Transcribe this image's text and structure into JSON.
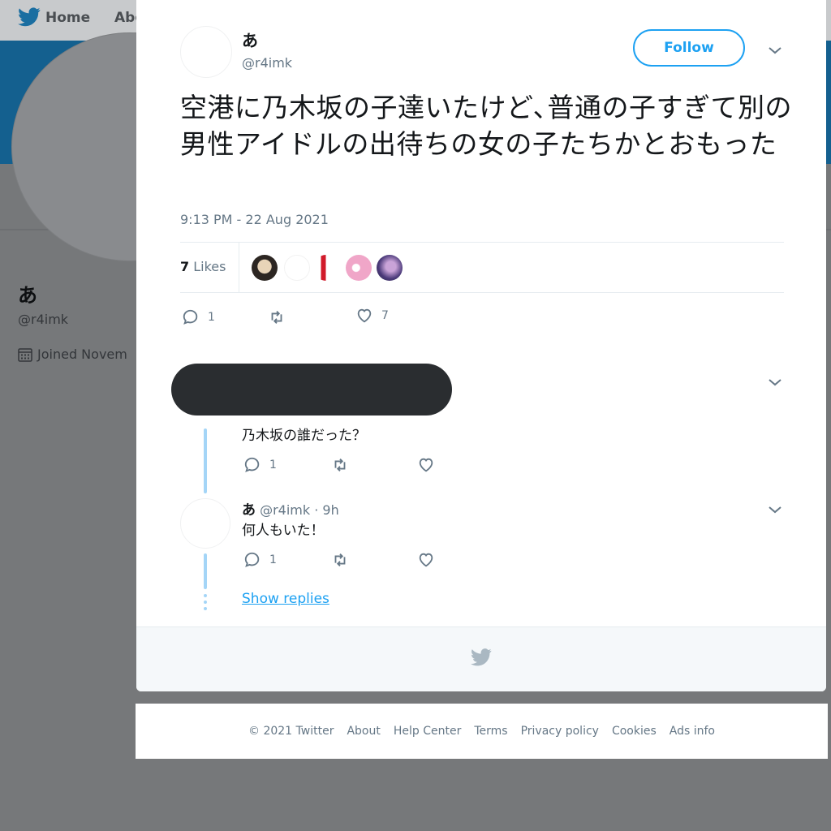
{
  "background": {
    "nav": {
      "home": "Home",
      "about": "Abo"
    },
    "profile": {
      "name": "あ",
      "handle": "@r4imk",
      "joined": "Joined Novem"
    },
    "colors": {
      "banner": "#14608f",
      "overlay": "#76787a"
    }
  },
  "tweet": {
    "author_name": "あ",
    "author_handle": "@r4imk",
    "follow_label": "Follow",
    "text": "空港に乃木坂の子達いたけど､普通の子すぎて別の男性アイドルの出待ちの女の子たちかとおもった",
    "timestamp": "9:13 PM - 22 Aug 2021",
    "likes_number": "7",
    "likes_label": "Likes",
    "reply_count": "1",
    "like_count": "7"
  },
  "replies": [
    {
      "text": "乃木坂の誰だった？",
      "reply_count": "1"
    },
    {
      "author_name": "あ",
      "meta": "@r4imk · 9h",
      "text": "何人もいた！",
      "reply_count": "1"
    }
  ],
  "show_replies_label": "Show replies",
  "footer": {
    "links": [
      "© 2021 Twitter",
      "About",
      "Help Center",
      "Terms",
      "Privacy policy",
      "Cookies",
      "Ads info"
    ]
  },
  "colors": {
    "accent": "#1da1f2",
    "thread": "#a4d5f7",
    "redaction": "#2a2d30"
  }
}
